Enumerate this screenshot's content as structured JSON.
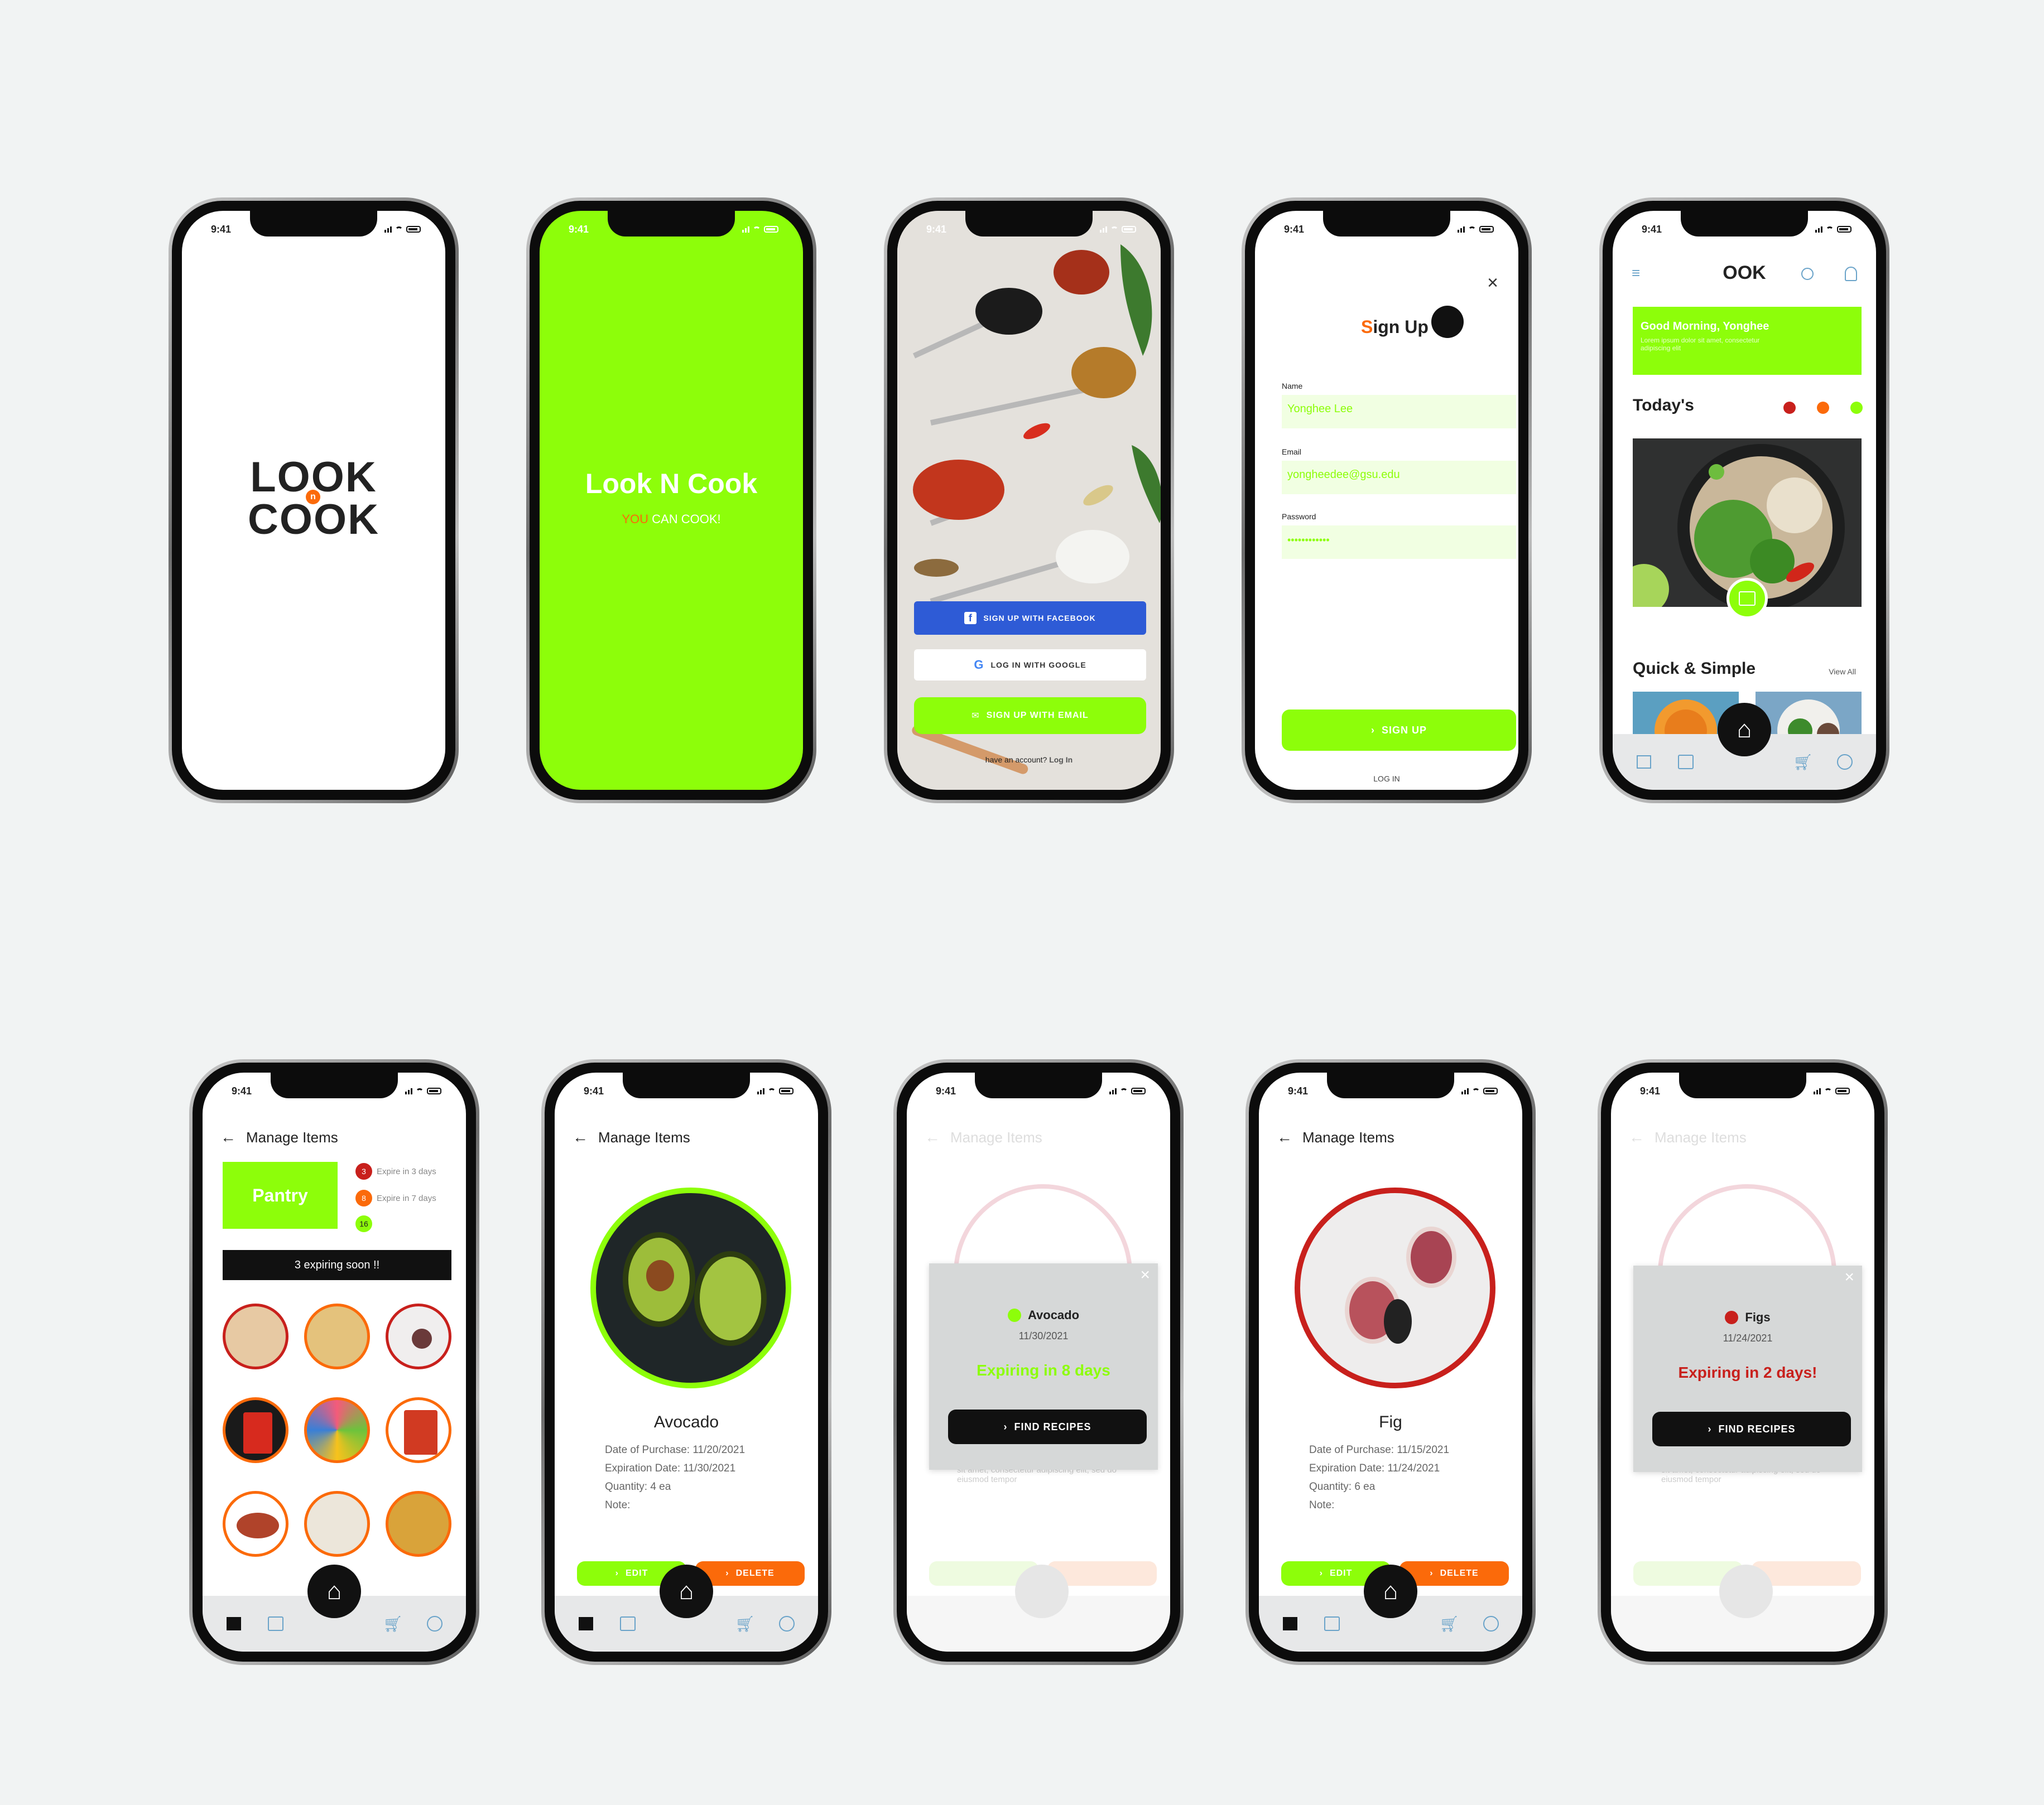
{
  "status_time": "9:41",
  "logo": {
    "line1": "LOOK",
    "line2": "COOK",
    "badge": "n"
  },
  "splash": {
    "title": "Look N Cook",
    "tag_you": "YOU",
    "tag_rest": "CAN COOK!"
  },
  "onboard": {
    "facebook": "SIGN UP WITH FACEBOOK",
    "google": "LOG IN WITH GOOGLE",
    "email": "SIGN UP WITH EMAIL",
    "have_account": "have an account?",
    "login_link": "Log In"
  },
  "signup": {
    "title_s": "S",
    "title_rest": "ign Up",
    "name_label": "Name",
    "name_value": "Yonghee Lee",
    "email_label": "Email",
    "email_value": "yongheedee@gsu.edu",
    "password_label": "Password",
    "password_value": "••••••••••••",
    "submit": "SIGN UP",
    "login": "LOG IN"
  },
  "home": {
    "logo": "OOK",
    "greeting": "Good Morning, Yonghee",
    "greeting_sub": "Lorem ipsum dolor sit amet, consectetur adipiscing elit",
    "todays": "Today's",
    "quick": "Quick & Simple",
    "view_all": "View All"
  },
  "manage": {
    "title": "Manage Items",
    "pantry": "Pantry",
    "legend": [
      {
        "count": "3",
        "label": "Expire in 3 days",
        "color": "#c8201c"
      },
      {
        "count": "8",
        "label": "Expire in 7 days",
        "color": "#fb6a0a"
      },
      {
        "count": "16",
        "label": "",
        "color": "#8dfe0a"
      }
    ],
    "expiring_banner": "3 expiring soon !!"
  },
  "avocado": {
    "name": "Avocado",
    "purchase": "Date of Purchase: 11/20/2021",
    "expiration": "Expiration Date: 11/30/2021",
    "quantity": "Quantity: 4 ea",
    "note": "Note:",
    "edit": "EDIT",
    "delete": "DELETE"
  },
  "avocado_popup": {
    "name": "Avocado",
    "date": "11/30/2021",
    "status": "Expiring in 8 days",
    "button": "FIND RECIPES",
    "bg_text": "sit amet, consectetur adipiscing elit, sed do eiusmod tempor"
  },
  "fig": {
    "name": "Fig",
    "purchase": "Date of Purchase: 11/15/2021",
    "expiration": "Expiration Date: 11/24/2021",
    "quantity": "Quantity: 6 ea",
    "note": "Note:",
    "edit": "EDIT",
    "delete": "DELETE"
  },
  "fig_popup": {
    "name": "Figs",
    "date": "11/24/2021",
    "status": "Expiring in 2 days!",
    "button": "FIND RECIPES",
    "bg_text": "sit amet, consectetur adipiscing elit, sed do eiusmod tempor"
  },
  "colors": {
    "lime": "#8dfe0a",
    "orange": "#fb6a0a",
    "red": "#c8201c",
    "facebook": "#2e5bd6",
    "dark": "#111111"
  }
}
